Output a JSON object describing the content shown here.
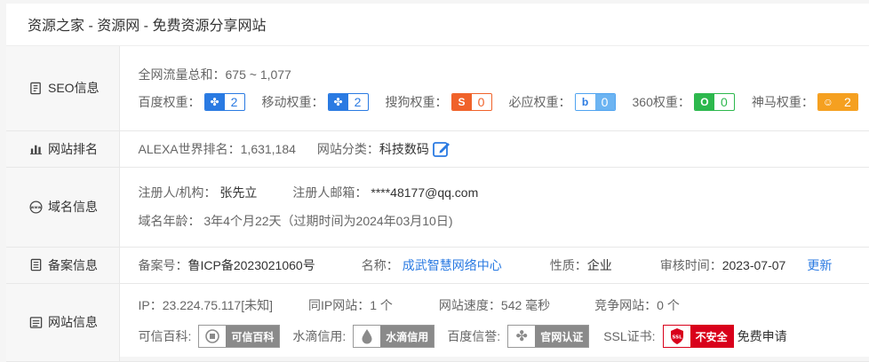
{
  "page_title": "资源之家 - 资源网 - 免费资源分享网站",
  "seo": {
    "label": "SEO信息",
    "traffic": "全网流量总和：675 ~ 1,077",
    "weights": [
      {
        "label": "百度权重：",
        "value": "2",
        "icon": "paw-icon",
        "color": "#2a7ae2"
      },
      {
        "label": "移动权重：",
        "value": "2",
        "icon": "paw-icon",
        "color": "#2a7ae2"
      },
      {
        "label": "搜狗权重：",
        "value": "0",
        "icon": "sogou-icon",
        "color": "#f0622a"
      },
      {
        "label": "必应权重：",
        "value": "0",
        "icon": "bing-icon",
        "color": "#4fa3f0"
      },
      {
        "label": "360权重：",
        "value": "0",
        "icon": "360-icon",
        "color": "#2db84d"
      },
      {
        "label": "神马权重：",
        "value": "2",
        "icon": "shenma-icon",
        "color": "#f5a020"
      }
    ]
  },
  "rank": {
    "label": "网站排名",
    "alexa": "ALEXA世界排名：1,631,184",
    "category_label": "网站分类：",
    "category": "科技数码"
  },
  "domain": {
    "label": "域名信息",
    "registrant_label": "注册人/机构：",
    "registrant": "张先立",
    "email_label": "注册人邮箱：",
    "email": "****48177@qq.com",
    "age": "域名年龄： 3年4个月22天（过期时间为2024年03月10日)"
  },
  "icp": {
    "label": "备案信息",
    "number_label": "备案号：",
    "number": "鲁ICP备2023021060号",
    "name_label": "名称：",
    "name": "成武智慧网络中心",
    "nature_label": "性质：",
    "nature": "企业",
    "audit_label": "审核时间：",
    "audit": "2023-07-07",
    "update": "更新"
  },
  "site": {
    "label": "网站信息",
    "ip": "IP：23.224.75.117[未知]",
    "same_ip": "同IP网站：1 个",
    "speed": "网站速度：542 毫秒",
    "competitors": "竞争网站：0 个",
    "baike_label": "可信百科:",
    "baike_badge": "可信百科",
    "water_label": "水滴信用:",
    "water_badge": "水滴信用",
    "baidu_label": "百度信誉:",
    "baidu_badge": "官网认证",
    "ssl_label": "SSL证书:",
    "ssl_badge": "不安全",
    "ssl_apply": "免费申请"
  }
}
